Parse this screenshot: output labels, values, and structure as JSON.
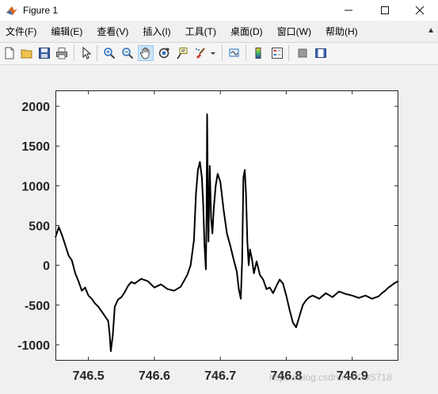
{
  "window": {
    "title": "Figure 1"
  },
  "menu": [
    "文件(F)",
    "编辑(E)",
    "查看(V)",
    "插入(I)",
    "工具(T)",
    "桌面(D)",
    "窗口(W)",
    "帮助(H)"
  ],
  "toolbar": [
    "new-figure",
    "open-file",
    "save",
    "print",
    "edit-plot",
    "zoom-in",
    "zoom-out",
    "pan",
    "rotate-3d",
    "data-cursor",
    "brush",
    "link-plot",
    "colorbar",
    "legend",
    "hide-plot-tools",
    "show-plot-tools"
  ],
  "watermark": "https://blog.csdn.net/G9S718",
  "chart_data": {
    "type": "line",
    "xlim": [
      746.45,
      746.97
    ],
    "ylim": [
      -1200,
      2200
    ],
    "xticks": [
      746.5,
      746.6,
      746.7,
      746.8,
      746.9
    ],
    "xtick_labels": [
      "746.5",
      "746.6",
      "746.7",
      "746.8",
      "746.9"
    ],
    "yticks": [
      -1000,
      -500,
      0,
      500,
      1000,
      1500,
      2000
    ],
    "ytick_labels": [
      "-1000",
      "-500",
      "0",
      "500",
      "1000",
      "1500",
      "2000"
    ],
    "title": "",
    "xlabel": "",
    "ylabel": "",
    "grid": false,
    "line_color": "#000000",
    "x": [
      746.45,
      746.455,
      746.46,
      746.465,
      746.47,
      746.475,
      746.48,
      746.485,
      746.49,
      746.495,
      746.5,
      746.505,
      746.51,
      746.515,
      746.52,
      746.525,
      746.53,
      746.532,
      746.534,
      746.537,
      746.54,
      746.545,
      746.55,
      746.555,
      746.56,
      746.565,
      746.57,
      746.58,
      746.59,
      746.6,
      746.61,
      746.62,
      746.63,
      746.64,
      746.65,
      746.655,
      746.66,
      746.663,
      746.666,
      746.669,
      746.672,
      746.674,
      746.676,
      746.678,
      746.679,
      746.68,
      746.681,
      746.682,
      746.684,
      746.686,
      746.688,
      746.69,
      746.693,
      746.696,
      746.7,
      746.705,
      746.71,
      746.715,
      746.72,
      746.725,
      746.728,
      746.731,
      746.733,
      746.735,
      746.737,
      746.739,
      746.741,
      746.743,
      746.745,
      746.748,
      746.751,
      746.755,
      746.76,
      746.765,
      746.77,
      746.775,
      746.78,
      746.785,
      746.79,
      746.795,
      746.8,
      746.805,
      746.81,
      746.815,
      746.82,
      746.825,
      746.83,
      746.835,
      746.84,
      746.85,
      746.86,
      746.87,
      746.88,
      746.89,
      746.9,
      746.91,
      746.92,
      746.93,
      746.94,
      746.945,
      746.95,
      746.955,
      746.96,
      746.965,
      746.97
    ],
    "y": [
      350,
      480,
      380,
      250,
      120,
      60,
      -100,
      -200,
      -320,
      -280,
      -380,
      -420,
      -480,
      -520,
      -580,
      -640,
      -700,
      -850,
      -1080,
      -880,
      -520,
      -430,
      -400,
      -340,
      -260,
      -210,
      -230,
      -170,
      -200,
      -280,
      -240,
      -300,
      -320,
      -270,
      -120,
      0,
      320,
      900,
      1200,
      1300,
      1100,
      780,
      250,
      -50,
      500,
      1900,
      900,
      300,
      1250,
      600,
      400,
      700,
      1000,
      1150,
      1050,
      700,
      400,
      250,
      80,
      -80,
      -300,
      -420,
      50,
      1100,
      1200,
      900,
      300,
      0,
      200,
      80,
      -100,
      50,
      -120,
      -180,
      -300,
      -280,
      -350,
      -260,
      -180,
      -230,
      -380,
      -560,
      -720,
      -780,
      -640,
      -500,
      -440,
      -400,
      -380,
      -420,
      -350,
      -400,
      -330,
      -360,
      -380,
      -410,
      -380,
      -420,
      -390,
      -350,
      -320,
      -280,
      -250,
      -220,
      -200
    ]
  }
}
